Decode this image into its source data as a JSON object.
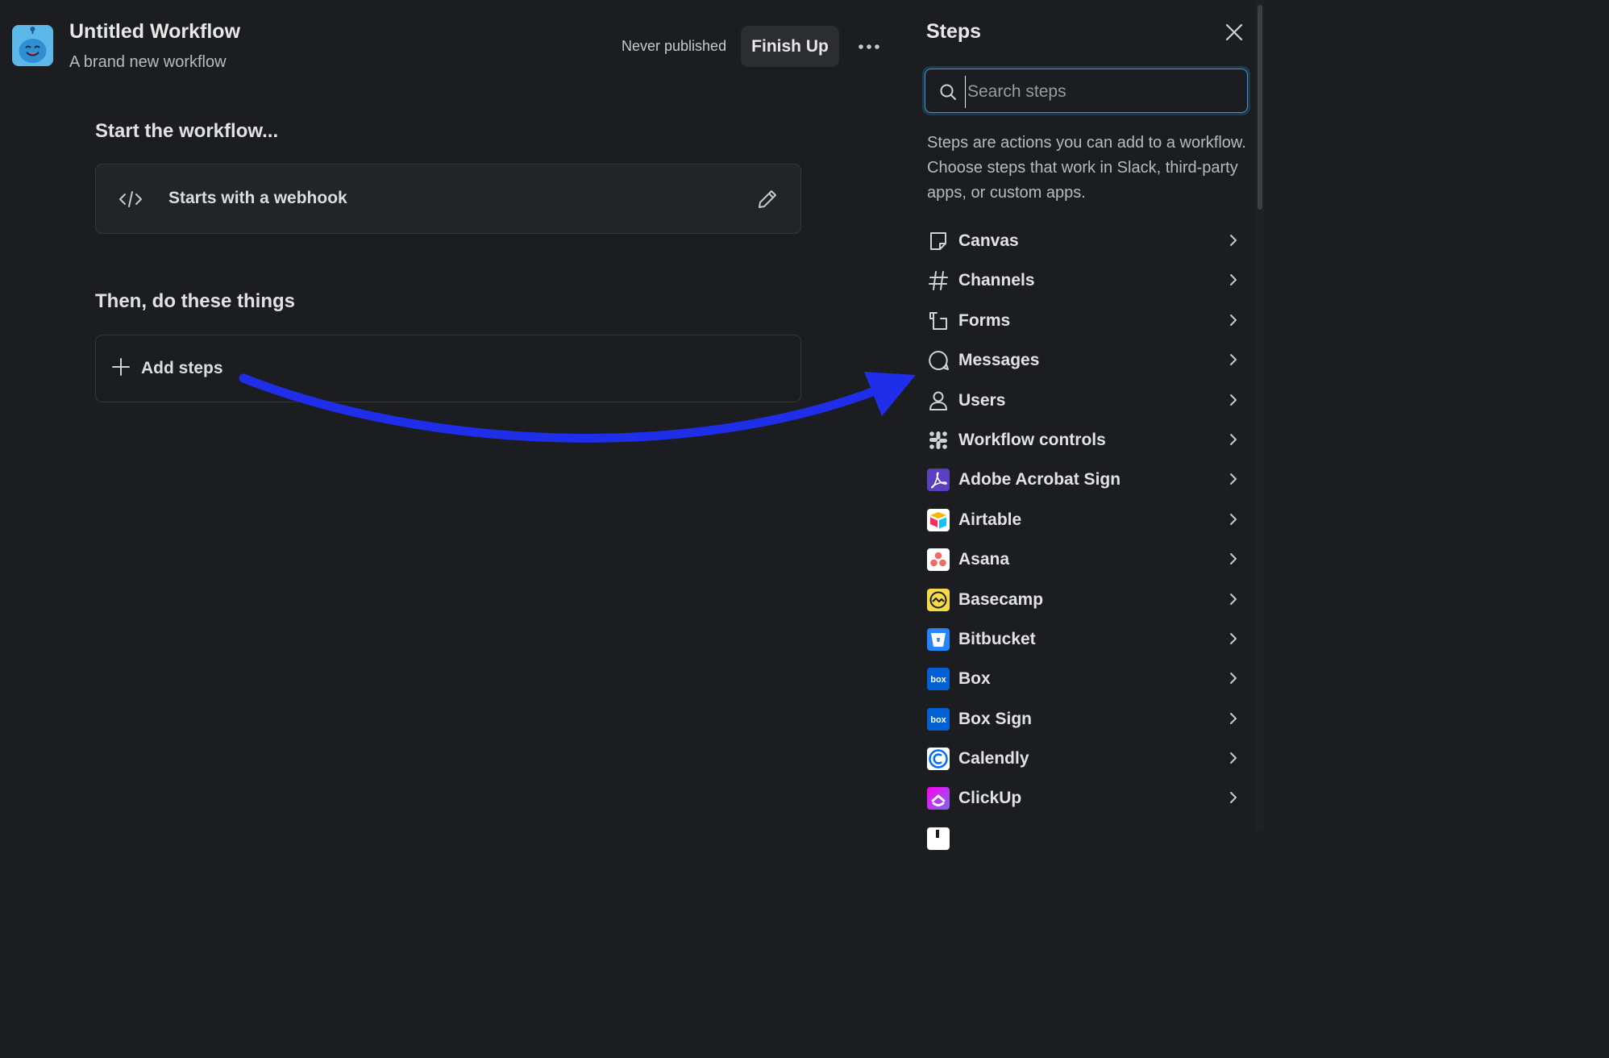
{
  "workflow": {
    "title": "Untitled Workflow",
    "subtitle": "A brand new workflow",
    "publish_status": "Never published",
    "finish_label": "Finish Up"
  },
  "start_section": {
    "heading": "Start the workflow...",
    "trigger_label": "Starts with a webhook"
  },
  "then_section": {
    "heading": "Then, do these things",
    "add_label": "Add steps"
  },
  "annotation": {
    "arrow_color": "#1f2ee8"
  },
  "panel": {
    "title": "Steps",
    "search_placeholder": "Search steps",
    "description": "Steps are actions you can add to a workflow. Choose steps that work in Slack, third-party apps, or custom apps.",
    "steps": [
      {
        "label": "Canvas",
        "icon": "canvas-icon"
      },
      {
        "label": "Channels",
        "icon": "hash-icon"
      },
      {
        "label": "Forms",
        "icon": "form-icon"
      },
      {
        "label": "Messages",
        "icon": "message-icon"
      },
      {
        "label": "Users",
        "icon": "user-icon"
      },
      {
        "label": "Workflow controls",
        "icon": "slack-icon"
      },
      {
        "label": "Adobe Acrobat Sign",
        "icon": "adobe-acrobat-icon",
        "color": "#5a3fc0"
      },
      {
        "label": "Airtable",
        "icon": "airtable-icon"
      },
      {
        "label": "Asana",
        "icon": "asana-icon",
        "color": "#f06a6a"
      },
      {
        "label": "Basecamp",
        "icon": "basecamp-icon",
        "color": "#f5d946"
      },
      {
        "label": "Bitbucket",
        "icon": "bitbucket-icon",
        "color": "#2684ff"
      },
      {
        "label": "Box",
        "icon": "box-icon",
        "color": "#0061d5",
        "badge": "box"
      },
      {
        "label": "Box Sign",
        "icon": "box-icon",
        "color": "#0061d5",
        "badge": "box"
      },
      {
        "label": "Calendly",
        "icon": "calendly-icon",
        "color": "#006bff"
      },
      {
        "label": "ClickUp",
        "icon": "clickup-icon"
      }
    ]
  }
}
